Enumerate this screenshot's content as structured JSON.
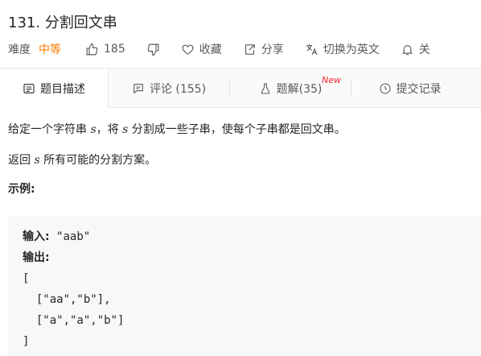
{
  "problem": {
    "title": "131. 分割回文串",
    "difficulty_label": "难度",
    "difficulty": "中等",
    "likes": "185",
    "favorite_label": "收藏",
    "share_label": "分享",
    "switch_lang_label": "切换为英文",
    "follow_label": "关"
  },
  "tabs": [
    {
      "label": "题目描述",
      "icon": "description-icon"
    },
    {
      "label": "评论 (155)",
      "icon": "comment-icon"
    },
    {
      "label": "题解(35)",
      "icon": "flask-icon",
      "badge": "New"
    },
    {
      "label": "提交记录",
      "icon": "clock-icon"
    }
  ],
  "description": {
    "line1_a": "给定一个字符串 ",
    "line1_var": "s",
    "line1_b": "，将 ",
    "line1_var2": "s",
    "line1_c": " 分割成一些子串，使每个子串都是回文串。",
    "line2_a": "返回 ",
    "line2_var": "s",
    "line2_b": " 所有可能的分割方案。",
    "example_title": "示例:"
  },
  "example": {
    "input_label": "输入:",
    "input_value": " \"aab\"",
    "output_label": "输出:",
    "output_lines": [
      "[",
      "  [\"aa\",\"b\"],",
      "  [\"a\",\"a\",\"b\"]",
      "]"
    ]
  },
  "colors": {
    "difficulty": "#ff7a00",
    "badge": "#f5222d",
    "code_bg": "#f7f8fa"
  }
}
